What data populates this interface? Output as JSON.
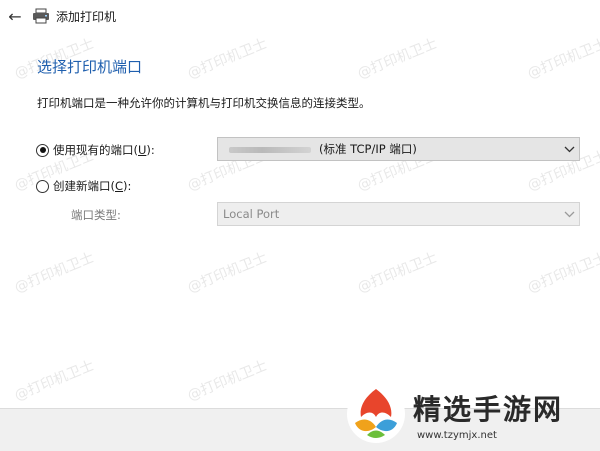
{
  "window": {
    "back_icon": "back-arrow-icon",
    "printer_icon": "printer-icon",
    "title": "添加打印机"
  },
  "page": {
    "heading": "选择打印机端口",
    "description": "打印机端口是一种允许你的计算机与打印机交换信息的连接类型。"
  },
  "use_existing": {
    "label_prefix": "使用现有的端口(",
    "label_key": "U",
    "label_suffix": "):",
    "selected": true,
    "port_value": "(标准 TCP/IP 端口)"
  },
  "create_new": {
    "label_prefix": "创建新端口(",
    "label_key": "C",
    "label_suffix": "):",
    "selected": false,
    "port_type_label": "端口类型:",
    "port_type_value": "Local Port"
  },
  "watermark": {
    "text": "@打印机卫士"
  },
  "site": {
    "name": "精选手游网",
    "url": "www.tzymjx.net"
  }
}
